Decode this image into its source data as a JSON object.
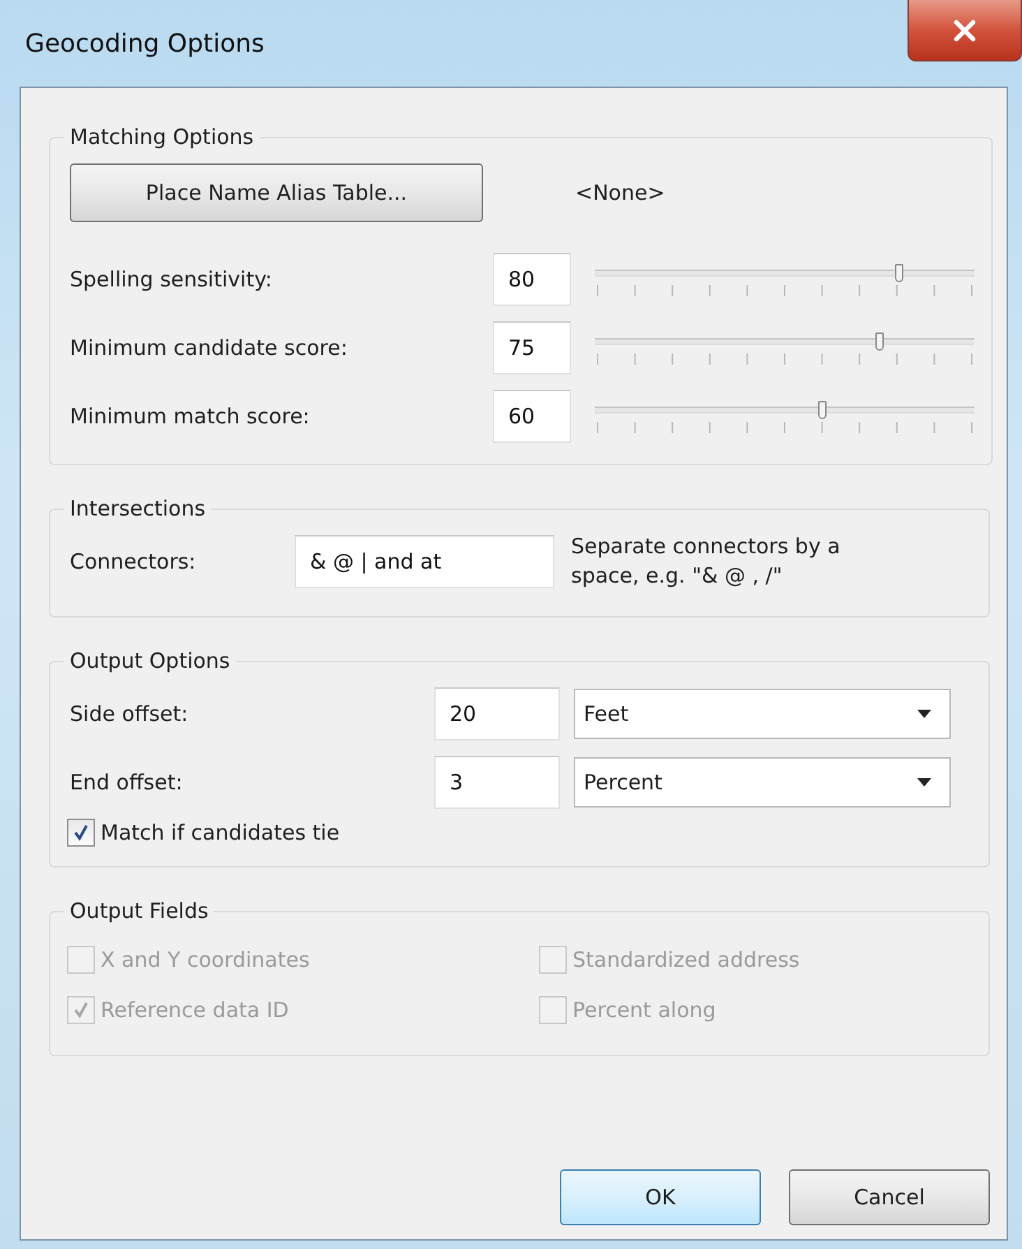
{
  "window": {
    "title": "Geocoding Options"
  },
  "matching_options": {
    "title": "Matching Options",
    "alias_button": "Place Name Alias Table...",
    "alias_table": "<None>",
    "settings": [
      {
        "label": "Spelling sensitivity:",
        "value": "80",
        "level": 0.8
      },
      {
        "label": "Minimum candidate score:",
        "value": "75",
        "level": 0.75
      },
      {
        "label": "Minimum match score:",
        "value": "60",
        "level": 0.6
      }
    ]
  },
  "intersections": {
    "title": "Intersections",
    "connectors_label": "Connectors:",
    "connectors_value": "& @ | and at",
    "hint": "Separate connectors by a space, e.g. \"& @ , /\""
  },
  "output_options": {
    "title": "Output Options",
    "offsets": [
      {
        "label": "Side offset:",
        "value": "20",
        "unit": "Feet"
      },
      {
        "label": "End offset:",
        "value": "3",
        "unit": "Percent"
      }
    ],
    "tie_checkbox": {
      "label": "Match if candidates tie",
      "checked": true,
      "disabled": false
    }
  },
  "output_fields": {
    "title": "Output Fields",
    "fields": [
      {
        "label": "X and Y coordinates",
        "checked": false,
        "disabled": true
      },
      {
        "label": "Standardized address",
        "checked": false,
        "disabled": true
      },
      {
        "label": "Reference data ID",
        "checked": true,
        "disabled": true
      },
      {
        "label": "Percent along",
        "checked": false,
        "disabled": true
      }
    ]
  },
  "buttons": [
    {
      "label": "OK",
      "default": true
    },
    {
      "label": "Cancel",
      "default": false
    }
  ]
}
